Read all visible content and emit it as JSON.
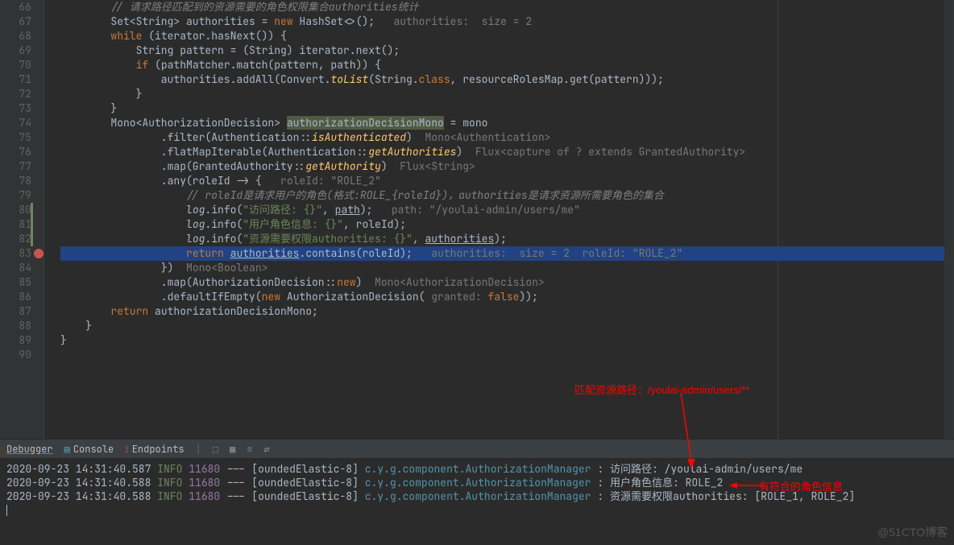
{
  "lines": {
    "l66": {
      "n": "66",
      "cm": "// 请求路径匹配到的资源需要的角色权限集合authorities统计"
    },
    "l67": {
      "n": "67",
      "t1": "Set<String> authorities = ",
      "kw": "new",
      "t2": " HashSet<>();   ",
      "hint": "authorities:  size = 2"
    },
    "l68": {
      "n": "68",
      "kw": "while",
      "t": " (iterator.hasNext()) {"
    },
    "l69": {
      "n": "69",
      "t1": "    String pattern = (String) iterator.next();"
    },
    "l70": {
      "n": "70",
      "kw": "if",
      "t": " (pathMatcher.match(pattern, path)) {"
    },
    "l71": {
      "n": "71",
      "t1": "        authorities.addAll(Convert.",
      "fn": "toList",
      "t2": "(String.",
      "kw": "class",
      "t3": ", resourceRolesMap.get(pattern)));"
    },
    "l72": {
      "n": "72",
      "t": "    }"
    },
    "l73": {
      "n": "73",
      "t": "}"
    },
    "l74": {
      "n": "74",
      "t1": "Mono<AuthorizationDecision> ",
      "hl": "authorizationDecisionMono",
      "t2": " = mono"
    },
    "l75": {
      "n": "75",
      "t1": "        .filter(Authentication::",
      "fn": "isAuthenticated",
      "t2": ")  ",
      "hint": "Mono<Authentication>"
    },
    "l76": {
      "n": "76",
      "t1": "        .flatMapIterable(Authentication::",
      "fn": "getAuthorities",
      "t2": ")  ",
      "hint": "Flux<capture of ? extends GrantedAuthority>"
    },
    "l77": {
      "n": "77",
      "t1": "        .map(GrantedAuthority::",
      "fn": "getAuthority",
      "t2": ")  ",
      "hint": "Flux<String>"
    },
    "l78": {
      "n": "78",
      "t1": "        .any(roleId -> {   ",
      "hint": "roleId: \"ROLE_2\""
    },
    "l79": {
      "n": "79",
      "cm": "// roleId是请求用户的角色(格式:ROLE_{roleId})，authorities是请求资源所需要角色的集合"
    },
    "l80": {
      "n": "80",
      "obj": "log",
      "t1": ".info(",
      "str": "\"访问路径: {}\"",
      "t2": ", ",
      "und": "path",
      "t3": ");   ",
      "hint": "path: \"/youlai-admin/users/me\""
    },
    "l81": {
      "n": "81",
      "obj": "log",
      "t1": ".info(",
      "str": "\"用户角色信息: {}\"",
      "t2": ", roleId);"
    },
    "l82": {
      "n": "82",
      "obj": "log",
      "t1": ".info(",
      "str": "\"资源需要权限authorities: {}\"",
      "t2": ", ",
      "und": "authorities",
      "t3": ");"
    },
    "l83": {
      "n": "83",
      "kw": "return",
      "t1": " ",
      "und": "authorities",
      "t2": ".contains(roleId);   ",
      "hint": "authorities:  size = 2  roleId: \"ROLE_2\""
    },
    "l84": {
      "n": "84",
      "t": "})  ",
      "hint": "Mono<Boolean>"
    },
    "l85": {
      "n": "85",
      "t1": "        .map(AuthorizationDecision::",
      "kw": "new",
      "t2": ")  ",
      "hint": "Mono<AuthorizationDecision>"
    },
    "l86": {
      "n": "86",
      "t1": "        .defaultIfEmpty(",
      "kw": "new",
      "t2": " AuthorizationDecision( ",
      "pn": "granted:",
      "t3": " ",
      "kw2": "false",
      "t4": "));"
    },
    "l87": {
      "n": "87",
      "kw": "return",
      "t": " authorizationDecisionMono;"
    },
    "l88": {
      "n": "88",
      "t": "}"
    },
    "l89": {
      "n": "89",
      "t": "}"
    },
    "l90": {
      "n": "90",
      "t": ""
    }
  },
  "annotations": {
    "a1": "匹配资源路径：/youlai-admin/users/**",
    "a2": "有符合的角色信息"
  },
  "tabs": {
    "debugger": "Debugger",
    "console": "Console",
    "endpoints": "Endpoints"
  },
  "logs": [
    {
      "ts": "2020-09-23 14:31:40.587",
      "lvl": "INFO",
      "pid": "11680",
      "sep": "---",
      "thr": "[oundedElastic-8]",
      "cls": "c.y.g.component.AuthorizationManager",
      "col": ":",
      "msg": "访问路径: /youlai-admin/users/me"
    },
    {
      "ts": "2020-09-23 14:31:40.588",
      "lvl": "INFO",
      "pid": "11680",
      "sep": "---",
      "thr": "[oundedElastic-8]",
      "cls": "c.y.g.component.AuthorizationManager",
      "col": ":",
      "msg": "用户角色信息: ROLE_2"
    },
    {
      "ts": "2020-09-23 14:31:40.588",
      "lvl": "INFO",
      "pid": "11680",
      "sep": "---",
      "thr": "[oundedElastic-8]",
      "cls": "c.y.g.component.AuthorizationManager",
      "col": ":",
      "msg": "资源需要权限authorities: [ROLE_1, ROLE_2]"
    }
  ],
  "watermark": "@51CTO博客"
}
